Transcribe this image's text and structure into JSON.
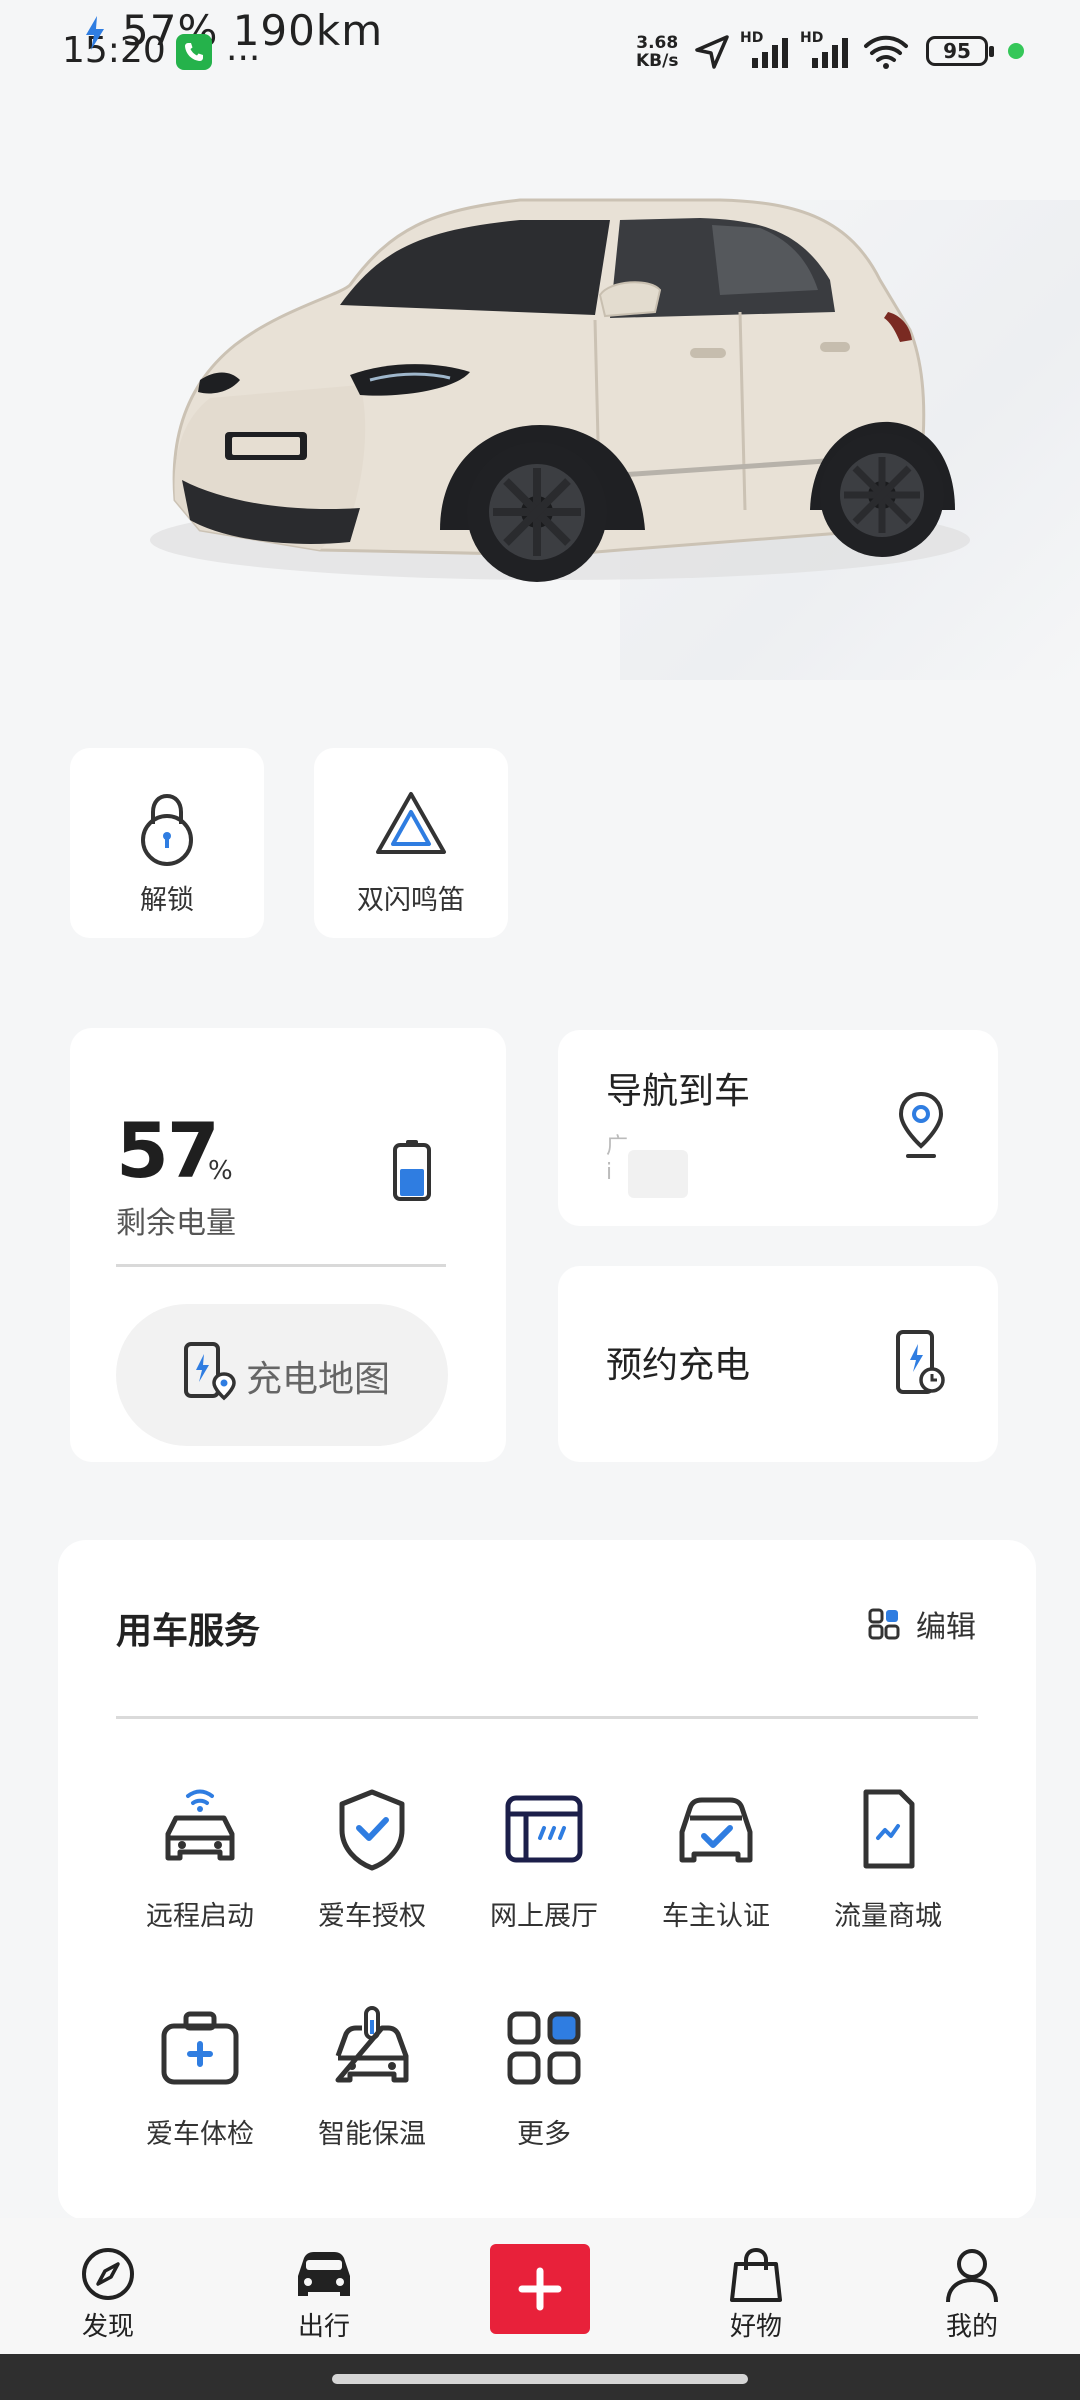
{
  "status_bar": {
    "time": "15:20",
    "overlay": "57%   190km",
    "dots": "...",
    "net_speed_value": "3.68",
    "net_speed_unit": "KB/s",
    "battery": "95",
    "hd1": "HD",
    "hd2": "HD"
  },
  "quick_actions": [
    {
      "label": "解锁",
      "icon": "lock-icon"
    },
    {
      "label": "双闪鸣笛",
      "icon": "hazard-triangle-icon"
    }
  ],
  "battery_card": {
    "value": "57",
    "unit": "%",
    "label": "剩余电量",
    "level": 0.57,
    "charge_map_label": "充电地图"
  },
  "nav_card": {
    "title": "导航到车",
    "sub1": "广",
    "sub2": "i"
  },
  "reserve_card": {
    "title": "预约充电"
  },
  "services": {
    "title": "用车服务",
    "edit_label": "编辑",
    "items": [
      {
        "label": "远程启动",
        "icon": "remote-start-car-icon"
      },
      {
        "label": "爱车授权",
        "icon": "shield-check-icon"
      },
      {
        "label": "网上展厅",
        "icon": "showroom-window-icon"
      },
      {
        "label": "车主认证",
        "icon": "car-owner-verify-icon"
      },
      {
        "label": "流量商城",
        "icon": "data-sim-icon"
      },
      {
        "label": "爱车体检",
        "icon": "medical-kit-icon"
      },
      {
        "label": "智能保温",
        "icon": "car-thermometer-icon"
      },
      {
        "label": "更多",
        "icon": "grid-more-icon"
      }
    ]
  },
  "bottom_nav": [
    {
      "label": "发现",
      "icon": "compass-icon"
    },
    {
      "label": "出行",
      "icon": "car-icon"
    },
    {
      "label": "",
      "icon": "plus-icon"
    },
    {
      "label": "好物",
      "icon": "shopping-bag-icon"
    },
    {
      "label": "我的",
      "icon": "profile-icon"
    }
  ],
  "colors": {
    "accent_red": "#e8213a",
    "accent_blue": "#2f7de1",
    "status_green": "#35c759"
  }
}
